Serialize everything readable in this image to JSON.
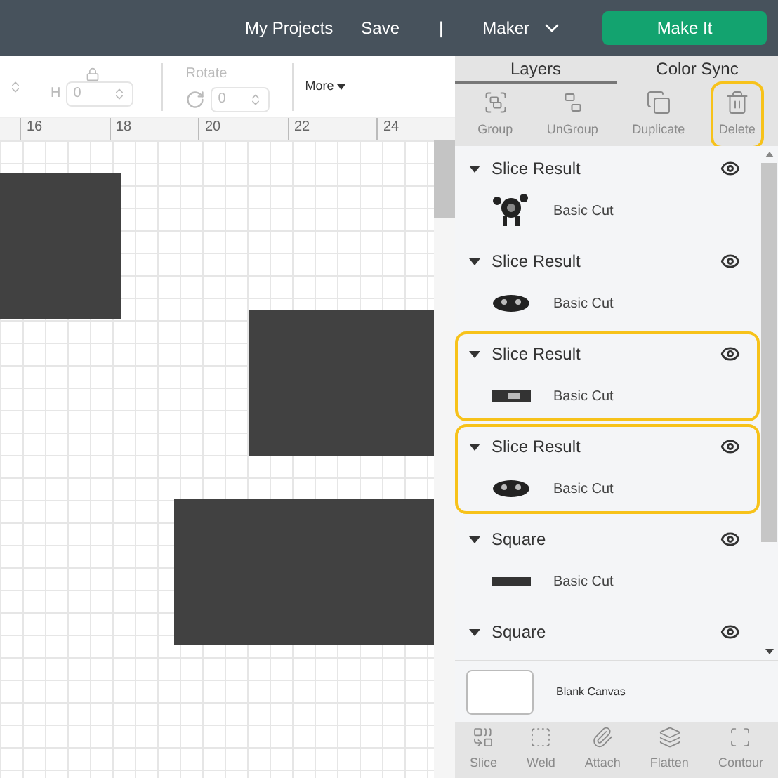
{
  "top_bar": {
    "links": [
      "My Projects",
      "Save"
    ],
    "separator": "|",
    "machine": "Maker",
    "make_button": "Make It"
  },
  "toolbar": {
    "size_field": {
      "label": "H",
      "value": "0"
    },
    "rotate": {
      "label": "Rotate",
      "value": "0"
    },
    "more": "More"
  },
  "ruler": {
    "labels": [
      "16",
      "18",
      "20",
      "22",
      "24"
    ]
  },
  "panel": {
    "tabs": [
      {
        "label": "Layers",
        "selected": true
      },
      {
        "label": "Color Sync",
        "selected": false
      }
    ],
    "actions": [
      {
        "label": "Group",
        "kind": "group",
        "disabled": true,
        "highlighted": false
      },
      {
        "label": "UnGroup",
        "kind": "ungroup",
        "disabled": true,
        "highlighted": false
      },
      {
        "label": "Duplicate",
        "kind": "duplicate",
        "disabled": true,
        "highlighted": false
      },
      {
        "label": "Delete",
        "kind": "delete",
        "disabled": true,
        "highlighted": true
      }
    ],
    "layers": [
      {
        "name": "Slice Result",
        "kind": "figure",
        "operation": "Basic Cut",
        "highlighted": false
      },
      {
        "name": "Slice Result",
        "kind": "face",
        "operation": "Basic Cut",
        "highlighted": false
      },
      {
        "name": "Slice Result",
        "kind": "strip",
        "operation": "Basic Cut",
        "highlighted": true
      },
      {
        "name": "Slice Result",
        "kind": "face",
        "operation": "Basic Cut",
        "highlighted": true
      },
      {
        "name": "Square",
        "kind": "bar",
        "operation": "Basic Cut",
        "highlighted": false
      },
      {
        "name": "Square",
        "highlighted": false
      }
    ],
    "canvas_label": "Blank Canvas",
    "tools": [
      {
        "label": "Slice",
        "kind": "slice"
      },
      {
        "label": "Weld",
        "kind": "weld"
      },
      {
        "label": "Attach",
        "kind": "attach"
      },
      {
        "label": "Flatten",
        "kind": "flatten"
      },
      {
        "label": "Contour",
        "kind": "contour"
      }
    ]
  }
}
